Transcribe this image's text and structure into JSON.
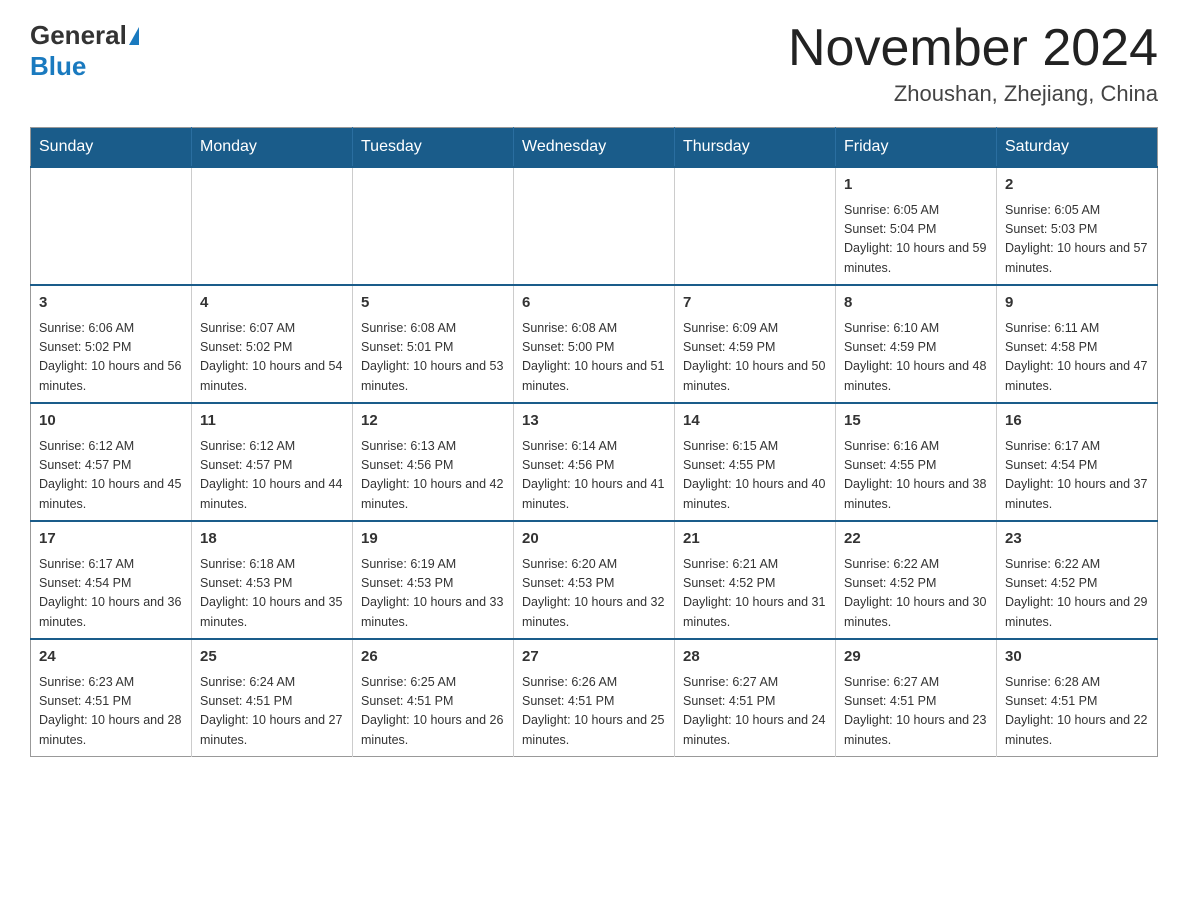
{
  "header": {
    "logo": {
      "general": "General",
      "blue": "Blue"
    },
    "title": "November 2024",
    "location": "Zhoushan, Zhejiang, China"
  },
  "days_of_week": [
    "Sunday",
    "Monday",
    "Tuesday",
    "Wednesday",
    "Thursday",
    "Friday",
    "Saturday"
  ],
  "weeks": [
    [
      {
        "day": "",
        "info": ""
      },
      {
        "day": "",
        "info": ""
      },
      {
        "day": "",
        "info": ""
      },
      {
        "day": "",
        "info": ""
      },
      {
        "day": "",
        "info": ""
      },
      {
        "day": "1",
        "info": "Sunrise: 6:05 AM\nSunset: 5:04 PM\nDaylight: 10 hours and 59 minutes."
      },
      {
        "day": "2",
        "info": "Sunrise: 6:05 AM\nSunset: 5:03 PM\nDaylight: 10 hours and 57 minutes."
      }
    ],
    [
      {
        "day": "3",
        "info": "Sunrise: 6:06 AM\nSunset: 5:02 PM\nDaylight: 10 hours and 56 minutes."
      },
      {
        "day": "4",
        "info": "Sunrise: 6:07 AM\nSunset: 5:02 PM\nDaylight: 10 hours and 54 minutes."
      },
      {
        "day": "5",
        "info": "Sunrise: 6:08 AM\nSunset: 5:01 PM\nDaylight: 10 hours and 53 minutes."
      },
      {
        "day": "6",
        "info": "Sunrise: 6:08 AM\nSunset: 5:00 PM\nDaylight: 10 hours and 51 minutes."
      },
      {
        "day": "7",
        "info": "Sunrise: 6:09 AM\nSunset: 4:59 PM\nDaylight: 10 hours and 50 minutes."
      },
      {
        "day": "8",
        "info": "Sunrise: 6:10 AM\nSunset: 4:59 PM\nDaylight: 10 hours and 48 minutes."
      },
      {
        "day": "9",
        "info": "Sunrise: 6:11 AM\nSunset: 4:58 PM\nDaylight: 10 hours and 47 minutes."
      }
    ],
    [
      {
        "day": "10",
        "info": "Sunrise: 6:12 AM\nSunset: 4:57 PM\nDaylight: 10 hours and 45 minutes."
      },
      {
        "day": "11",
        "info": "Sunrise: 6:12 AM\nSunset: 4:57 PM\nDaylight: 10 hours and 44 minutes."
      },
      {
        "day": "12",
        "info": "Sunrise: 6:13 AM\nSunset: 4:56 PM\nDaylight: 10 hours and 42 minutes."
      },
      {
        "day": "13",
        "info": "Sunrise: 6:14 AM\nSunset: 4:56 PM\nDaylight: 10 hours and 41 minutes."
      },
      {
        "day": "14",
        "info": "Sunrise: 6:15 AM\nSunset: 4:55 PM\nDaylight: 10 hours and 40 minutes."
      },
      {
        "day": "15",
        "info": "Sunrise: 6:16 AM\nSunset: 4:55 PM\nDaylight: 10 hours and 38 minutes."
      },
      {
        "day": "16",
        "info": "Sunrise: 6:17 AM\nSunset: 4:54 PM\nDaylight: 10 hours and 37 minutes."
      }
    ],
    [
      {
        "day": "17",
        "info": "Sunrise: 6:17 AM\nSunset: 4:54 PM\nDaylight: 10 hours and 36 minutes."
      },
      {
        "day": "18",
        "info": "Sunrise: 6:18 AM\nSunset: 4:53 PM\nDaylight: 10 hours and 35 minutes."
      },
      {
        "day": "19",
        "info": "Sunrise: 6:19 AM\nSunset: 4:53 PM\nDaylight: 10 hours and 33 minutes."
      },
      {
        "day": "20",
        "info": "Sunrise: 6:20 AM\nSunset: 4:53 PM\nDaylight: 10 hours and 32 minutes."
      },
      {
        "day": "21",
        "info": "Sunrise: 6:21 AM\nSunset: 4:52 PM\nDaylight: 10 hours and 31 minutes."
      },
      {
        "day": "22",
        "info": "Sunrise: 6:22 AM\nSunset: 4:52 PM\nDaylight: 10 hours and 30 minutes."
      },
      {
        "day": "23",
        "info": "Sunrise: 6:22 AM\nSunset: 4:52 PM\nDaylight: 10 hours and 29 minutes."
      }
    ],
    [
      {
        "day": "24",
        "info": "Sunrise: 6:23 AM\nSunset: 4:51 PM\nDaylight: 10 hours and 28 minutes."
      },
      {
        "day": "25",
        "info": "Sunrise: 6:24 AM\nSunset: 4:51 PM\nDaylight: 10 hours and 27 minutes."
      },
      {
        "day": "26",
        "info": "Sunrise: 6:25 AM\nSunset: 4:51 PM\nDaylight: 10 hours and 26 minutes."
      },
      {
        "day": "27",
        "info": "Sunrise: 6:26 AM\nSunset: 4:51 PM\nDaylight: 10 hours and 25 minutes."
      },
      {
        "day": "28",
        "info": "Sunrise: 6:27 AM\nSunset: 4:51 PM\nDaylight: 10 hours and 24 minutes."
      },
      {
        "day": "29",
        "info": "Sunrise: 6:27 AM\nSunset: 4:51 PM\nDaylight: 10 hours and 23 minutes."
      },
      {
        "day": "30",
        "info": "Sunrise: 6:28 AM\nSunset: 4:51 PM\nDaylight: 10 hours and 22 minutes."
      }
    ]
  ]
}
